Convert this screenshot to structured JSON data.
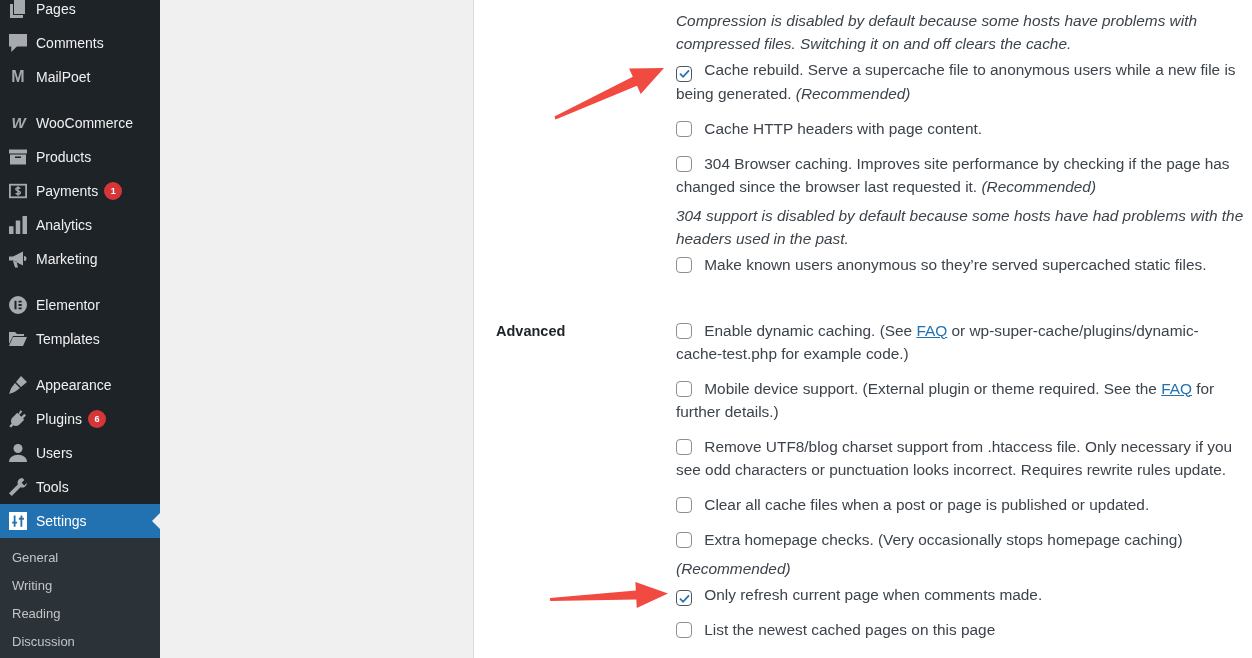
{
  "sidebar": {
    "groups": [
      {
        "items": [
          {
            "label": "Pages",
            "selected": false
          },
          {
            "label": "Comments",
            "selected": false
          },
          {
            "label": "MailPoet",
            "selected": false,
            "logo_letter": "M"
          }
        ]
      },
      {
        "items": [
          {
            "label": "WooCommerce",
            "selected": false,
            "logo_letter": "W"
          },
          {
            "label": "Products",
            "selected": false
          },
          {
            "label": "Payments",
            "selected": false,
            "badge": "1"
          },
          {
            "label": "Analytics",
            "selected": false
          },
          {
            "label": "Marketing",
            "selected": false
          }
        ]
      },
      {
        "items": [
          {
            "label": "Elementor",
            "selected": false
          },
          {
            "label": "Templates",
            "selected": false
          }
        ]
      },
      {
        "items": [
          {
            "label": "Appearance",
            "selected": false
          },
          {
            "label": "Plugins",
            "selected": false,
            "badge": "6"
          },
          {
            "label": "Users",
            "selected": false
          },
          {
            "label": "Tools",
            "selected": false
          },
          {
            "label": "Settings",
            "selected": true,
            "children": [
              {
                "label": "General",
                "selected": false
              },
              {
                "label": "Writing",
                "selected": false
              },
              {
                "label": "Reading",
                "selected": false
              },
              {
                "label": "Discussion",
                "selected": false
              }
            ]
          }
        ]
      }
    ]
  },
  "settings": {
    "rows": [
      {
        "options": [
          {
            "kind": "note",
            "text": "Compression is disabled by default because some hosts have problems with compressed files. Switching it on and off clears the cache."
          },
          {
            "kind": "checkbox",
            "checked": true,
            "arrow": {
              "kind": "slanted"
            },
            "parts": [
              {
                "kind": "text",
                "text": "Cache rebuild. Serve a supercache file to anonymous users while a new file is being generated. *(Recommended)*"
              }
            ]
          },
          {
            "kind": "checkbox",
            "checked": false,
            "parts": [
              {
                "kind": "text",
                "text": "Cache HTTP headers with page content."
              }
            ]
          },
          {
            "kind": "checkbox",
            "checked": false,
            "parts": [
              {
                "kind": "text",
                "text": "304 Browser caching. Improves site performance by checking if the page has changed since the browser last requested it. *(Recommended)*"
              }
            ]
          },
          {
            "kind": "note",
            "text": "304 support is disabled by default because some hosts have had problems with the headers used in the past."
          },
          {
            "kind": "checkbox",
            "checked": false,
            "parts": [
              {
                "kind": "text",
                "text": "Make known users anonymous so they’re served supercached static files."
              }
            ]
          }
        ]
      },
      {
        "label": "Advanced",
        "options": [
          {
            "kind": "checkbox",
            "checked": false,
            "parts": [
              {
                "kind": "text",
                "text": "Enable dynamic caching. (See "
              },
              {
                "kind": "link",
                "text": "FAQ"
              },
              {
                "kind": "text",
                "text": " or wp-super-cache/plugins/dynamic-cache-test.php for example code.)"
              }
            ]
          },
          {
            "kind": "checkbox",
            "checked": false,
            "parts": [
              {
                "kind": "text",
                "text": "Mobile device support. (External plugin or theme required. See the "
              },
              {
                "kind": "link",
                "text": "FAQ"
              },
              {
                "kind": "text",
                "text": " for further details.)"
              }
            ]
          },
          {
            "kind": "checkbox",
            "checked": false,
            "parts": [
              {
                "kind": "text",
                "text": "Remove UTF8/blog charset support from .htaccess file. Only necessary if you see odd characters or punctuation looks incorrect. Requires rewrite rules update."
              }
            ]
          },
          {
            "kind": "checkbox",
            "checked": false,
            "parts": [
              {
                "kind": "text",
                "text": "Clear all cache files when a post or page is published or updated."
              }
            ]
          },
          {
            "kind": "checkbox",
            "checked": false,
            "parts": [
              {
                "kind": "text",
                "text": "Extra homepage checks. (Very occasionally stops homepage caching)"
              }
            ]
          },
          {
            "kind": "note",
            "text": "(Recommended)"
          },
          {
            "kind": "checkbox",
            "checked": true,
            "arrow": {
              "kind": "straight"
            },
            "parts": [
              {
                "kind": "text",
                "text": "Only refresh current page when comments made."
              }
            ]
          },
          {
            "kind": "checkbox",
            "checked": false,
            "parts": [
              {
                "kind": "text",
                "text": "List the newest cached pages on this page"
              }
            ]
          }
        ]
      }
    ]
  }
}
